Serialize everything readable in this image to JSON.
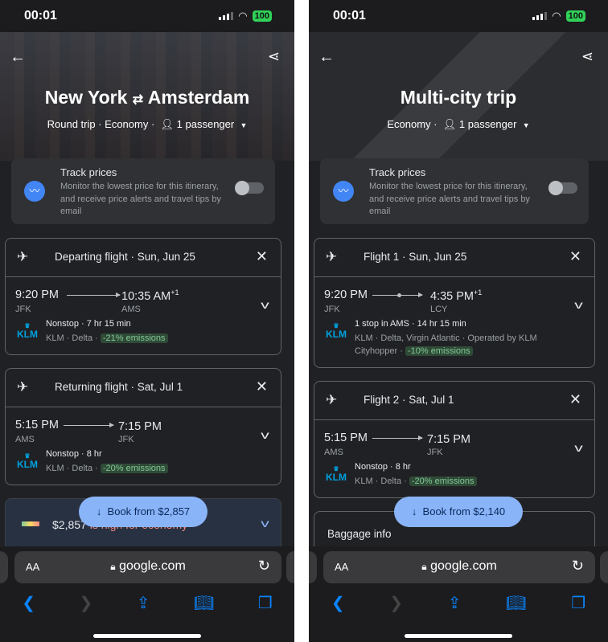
{
  "status_bar": {
    "time": "00:01",
    "battery": "100"
  },
  "browser": {
    "aa_label": "AA",
    "domain": "google.com",
    "lock_icon": "lock-icon",
    "reload_icon": "reload-icon",
    "nav_icons": [
      "back-icon",
      "forward-icon",
      "share-icon",
      "bookmarks-icon",
      "tabs-icon"
    ]
  },
  "accent": "#8ab4f8",
  "panels": [
    {
      "title_from": "New York",
      "title_swap": "⇄",
      "title_to": "Amsterdam",
      "title": "",
      "trip_type": "Round trip",
      "cabin": "Economy",
      "passengers": "1 passenger",
      "track": {
        "title": "Track prices",
        "desc": "Monitor the lowest price for this itinerary, and receive price alerts and travel tips by email",
        "enabled": false
      },
      "flights": [
        {
          "header": "Departing flight · Sun, Jun 25",
          "depart_time": "9:20 PM",
          "arrive_time": "10:35 AM",
          "plus_day": "+1",
          "from": "JFK",
          "to": "AMS",
          "stops": "Nonstop · 7 hr 15 min",
          "airlines": "KLM · Delta · ",
          "operated": "",
          "emissions": "-21% emissions",
          "one_stop": false
        },
        {
          "header": "Returning flight · Sat, Jul 1",
          "depart_time": "5:15 PM",
          "arrive_time": "7:15 PM",
          "plus_day": "",
          "from": "AMS",
          "to": "JFK",
          "stops": "Nonstop · 8 hr",
          "airlines": "KLM · Delta · ",
          "operated": "",
          "emissions": "-20% emissions",
          "one_stop": false
        }
      ],
      "price_summary": "$2,857",
      "price_note": "is high for economy",
      "book_label": "Book from $2,857"
    },
    {
      "title": "Multi-city trip",
      "trip_type": "",
      "cabin": "Economy",
      "passengers": "1 passenger",
      "track": {
        "title": "Track prices",
        "desc": "Monitor the lowest price for this itinerary, and receive price alerts and travel tips by email",
        "enabled": false
      },
      "flights": [
        {
          "header": "Flight 1 · Sun, Jun 25",
          "depart_time": "9:20 PM",
          "arrive_time": "4:35 PM",
          "plus_day": "+1",
          "from": "JFK",
          "to": "LCY",
          "stops": "1 stop in AMS · 14 hr 15 min",
          "airlines": "KLM · Delta, Virgin Atlantic · Operated by KLM Cityhopper · ",
          "emissions": "-10% emissions",
          "one_stop": true
        },
        {
          "header": "Flight 2 · Sat, Jul 1",
          "depart_time": "5:15 PM",
          "arrive_time": "7:15 PM",
          "plus_day": "",
          "from": "AMS",
          "to": "JFK",
          "stops": "Nonstop · 8 hr",
          "airlines": "KLM · Delta · ",
          "emissions": "-20% emissions",
          "one_stop": false
        }
      ],
      "baggage": "Baggage info",
      "book_label": "Book from $2,140"
    }
  ],
  "airline_logo": "KLM"
}
